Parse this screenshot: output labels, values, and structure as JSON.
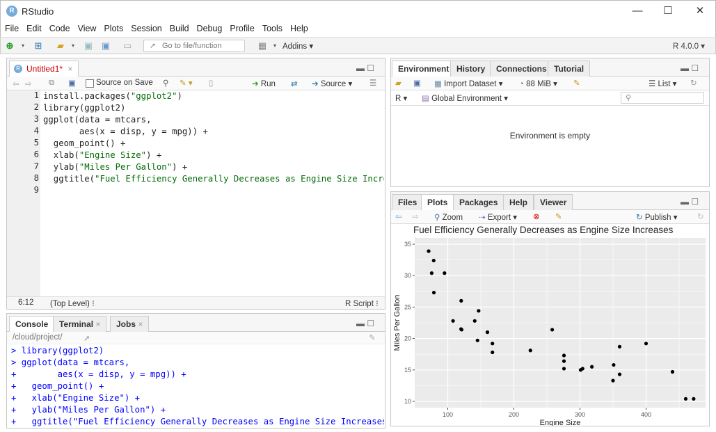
{
  "app": {
    "title": "RStudio",
    "logo_letter": "R"
  },
  "window_controls": {
    "minimize": "—",
    "maximize": "☐",
    "close": "✕"
  },
  "menu": [
    "File",
    "Edit",
    "Code",
    "View",
    "Plots",
    "Session",
    "Build",
    "Debug",
    "Profile",
    "Tools",
    "Help"
  ],
  "toolbar": {
    "goto_placeholder": "Go to file/function",
    "addins": "Addins",
    "r_version": "R 4.0.0"
  },
  "editor": {
    "tab_label": "Untitled1*",
    "source_on_save": "Source on Save",
    "run": "Run",
    "source": "Source",
    "line_numbers": [
      "1",
      "2",
      "3",
      "4",
      "5",
      "6",
      "7",
      "8",
      "9"
    ],
    "lines": [
      "install.packages(\"ggplot2\")",
      "library(ggplot2)",
      "ggplot(data = mtcars,",
      "       aes(x = disp, y = mpg)) +",
      "  geom_point() +",
      "  xlab(\"Engine Size\") +",
      "  ylab(\"Miles Per Gallon\") +",
      "  ggtitle(\"Fuel Efficiency Generally Decreases as Engine Size Increas",
      ""
    ],
    "status_position": "6:12",
    "status_scope": "(Top Level) ⁝",
    "status_type": "R Script ⁝"
  },
  "console": {
    "tabs": [
      "Console",
      "Terminal",
      "Jobs"
    ],
    "path": "/cloud/project/",
    "lines": [
      "> library(ggplot2)",
      "> ggplot(data = mtcars,",
      "+        aes(x = disp, y = mpg)) +",
      "+   geom_point() +",
      "+   xlab(\"Engine Size\") +",
      "+   ylab(\"Miles Per Gallon\") +",
      "+   ggtitle(\"Fuel Efficiency Generally Decreases as Engine Size Increases\")"
    ]
  },
  "environment": {
    "tabs": [
      "Environment",
      "History",
      "Connections",
      "Tutorial"
    ],
    "import_dataset": "Import Dataset",
    "memory": "88 MiB",
    "list_view": "List",
    "language": "R",
    "scope": "Global Environment",
    "empty_message": "Environment is empty"
  },
  "files_pane": {
    "tabs": [
      "Files",
      "Plots",
      "Packages",
      "Help",
      "Viewer"
    ],
    "zoom": "Zoom",
    "export": "Export",
    "publish": "Publish"
  },
  "chart_data": {
    "type": "scatter",
    "title": "Fuel Efficiency Generally Decreases as Engine Size Increases",
    "xlabel": "Engine Size",
    "ylabel": "Miles Per Gallon",
    "xlim": [
      50,
      490
    ],
    "ylim": [
      9,
      36
    ],
    "xticks": [
      100,
      200,
      300,
      400
    ],
    "yticks": [
      10,
      15,
      20,
      25,
      30,
      35
    ],
    "grid": true,
    "points": [
      [
        71.1,
        33.9
      ],
      [
        75.7,
        30.4
      ],
      [
        78.7,
        32.4
      ],
      [
        79,
        27.3
      ],
      [
        95.1,
        30.4
      ],
      [
        108,
        22.8
      ],
      [
        120.1,
        21.5
      ],
      [
        120.3,
        26
      ],
      [
        121,
        21.4
      ],
      [
        140.8,
        22.8
      ],
      [
        145,
        19.7
      ],
      [
        146.7,
        24.4
      ],
      [
        160,
        21
      ],
      [
        160,
        21
      ],
      [
        167.6,
        19.2
      ],
      [
        167.6,
        17.8
      ],
      [
        225,
        18.1
      ],
      [
        258,
        21.4
      ],
      [
        275.8,
        16.4
      ],
      [
        275.8,
        17.3
      ],
      [
        275.8,
        15.2
      ],
      [
        301,
        15
      ],
      [
        304,
        15.2
      ],
      [
        318,
        15.5
      ],
      [
        350,
        13.3
      ],
      [
        351,
        15.8
      ],
      [
        360,
        18.7
      ],
      [
        360,
        14.3
      ],
      [
        400,
        19.2
      ],
      [
        440,
        14.7
      ],
      [
        460,
        10.4
      ],
      [
        472,
        10.4
      ]
    ],
    "colors": {
      "panel": "#ebebeb",
      "grid": "#ffffff",
      "point": "#000000"
    }
  }
}
